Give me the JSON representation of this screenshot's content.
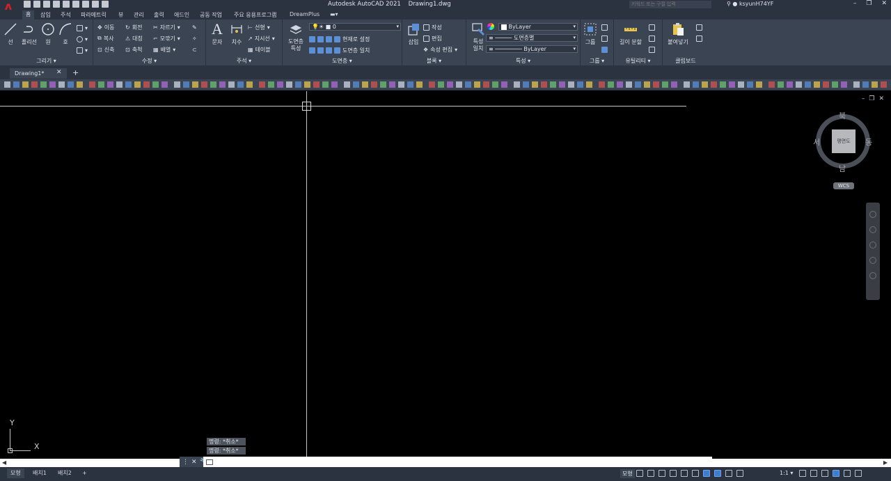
{
  "title_bar": {
    "app_title": "Autodesk AutoCAD 2021",
    "file_name": "Drawing1.dwg",
    "search_placeholder": "키워드 또는 구절 입력",
    "user_name": "ksyunH74YF",
    "window_controls": [
      "–",
      "❐",
      "✕"
    ]
  },
  "ribbon_tabs": [
    "홈",
    "삽입",
    "주석",
    "파라메트릭",
    "뷰",
    "관리",
    "출력",
    "애드인",
    "공동 작업",
    "주요 응용프로그램",
    "DreamPlus"
  ],
  "ribbon": {
    "draw": {
      "title": "그리기",
      "line": "선",
      "polyline": "폴리선",
      "circle": "원",
      "arc": "호"
    },
    "modify": {
      "title": "수정",
      "items": [
        "이동",
        "회전",
        "자르기",
        "복사",
        "대칭",
        "모깎기",
        "신축",
        "축척",
        "배열"
      ]
    },
    "annotation": {
      "title": "주석",
      "text": "문자",
      "dimension": "치수",
      "items": [
        "선형",
        "지시선",
        "테이블"
      ]
    },
    "layers": {
      "title": "도면층",
      "layer_properties": "도면층\n특성",
      "current_layer": "0",
      "items": [
        "현재로 설정",
        "도면층 일치"
      ]
    },
    "block": {
      "title": "블록",
      "insert": "삽입",
      "items": [
        "작성",
        "편집",
        "속성 편집"
      ]
    },
    "properties": {
      "title": "특성",
      "match": "특성\n일치",
      "color": "ByLayer",
      "linetype": "도면층별",
      "lineweight": "ByLayer"
    },
    "groups": {
      "title": "그룹",
      "group": "그룹"
    },
    "utilities": {
      "title": "유틸리티",
      "measure": "길이 분할"
    },
    "clipboard": {
      "title": "클립보드",
      "paste": "붙여넣기"
    }
  },
  "file_tabs": {
    "active": "Drawing1*",
    "close": "✕",
    "add": "+"
  },
  "viewcube": {
    "north": "북",
    "south": "남",
    "east": "동",
    "west": "서",
    "face": "평면도",
    "wcs": "WCS"
  },
  "ucs": {
    "x": "X",
    "y": "Y"
  },
  "command_history": [
    "명령: *취소*",
    "명령: *취소*"
  ],
  "command_line": {
    "value": ""
  },
  "layout_tabs": [
    "모형",
    "배치1",
    "배치2",
    "+"
  ],
  "status_bar": {
    "mode": "모형",
    "scale": "1:1"
  }
}
